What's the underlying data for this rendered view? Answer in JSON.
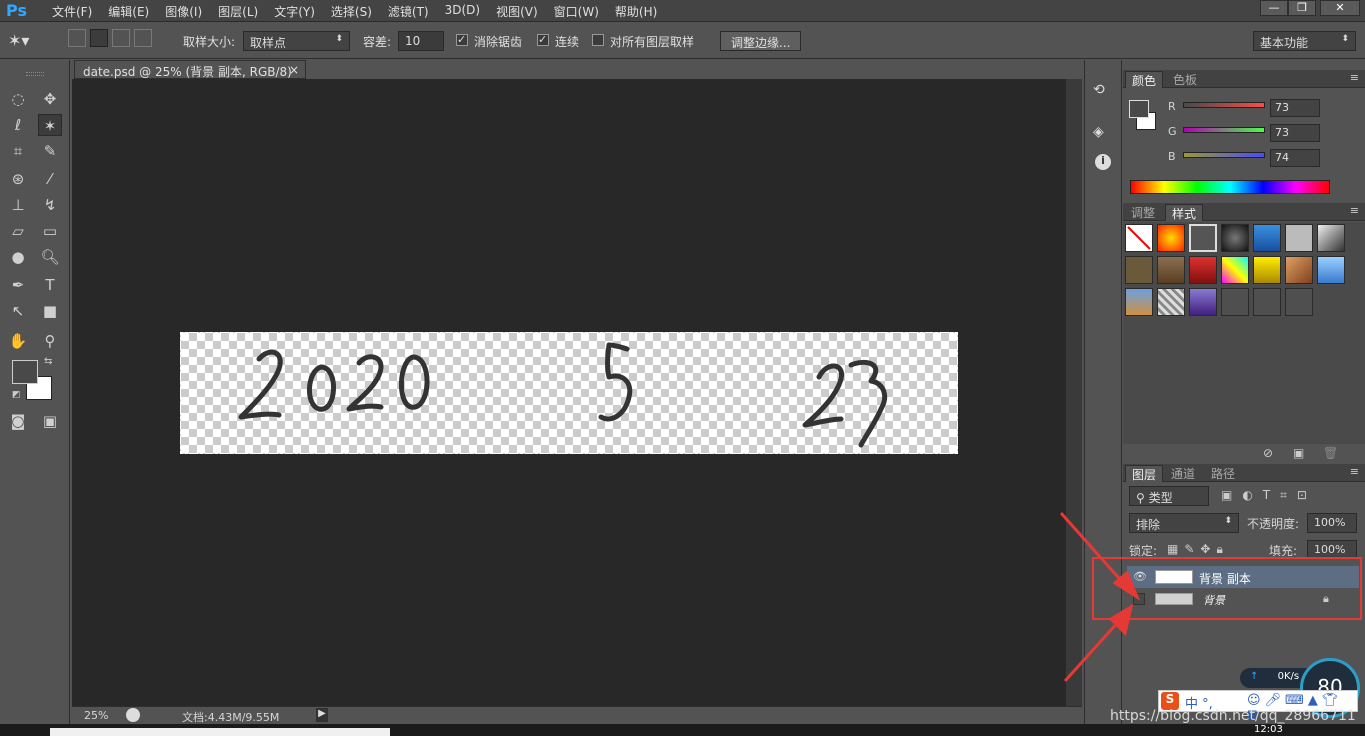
{
  "app": {
    "logo": "Ps",
    "menu": [
      "文件(F)",
      "编辑(E)",
      "图像(I)",
      "图层(L)",
      "文字(Y)",
      "选择(S)",
      "滤镜(T)",
      "3D(D)",
      "视图(V)",
      "窗口(W)",
      "帮助(H)"
    ],
    "window_controls": [
      "—",
      "❐",
      "✕"
    ]
  },
  "options_bar": {
    "sample_size_label": "取样大小:",
    "sample_size_value": "取样点",
    "tolerance_label": "容差:",
    "tolerance_value": "10",
    "antialias_label": "消除锯齿",
    "contiguous_label": "连续",
    "all_layers_label": "对所有图层取样",
    "refine_edge_button": "调整边缘...",
    "workspace_value": "基本功能"
  },
  "document": {
    "tab_title": "date.psd @ 25% (背景 副本, RGB/8) *",
    "tab_close": "×",
    "image_text": [
      "2020",
      "5",
      "23"
    ],
    "zoom": "25%",
    "doc_info": "文档:4.43M/9.55M"
  },
  "color_panel": {
    "tabs": [
      "颜色",
      "色板"
    ],
    "r_label": "R",
    "g_label": "G",
    "b_label": "B",
    "r_value": "73",
    "g_value": "73",
    "b_value": "74"
  },
  "styles_panel": {
    "tabs": [
      "调整",
      "样式"
    ]
  },
  "layers_panel": {
    "tabs": [
      "图层",
      "通道",
      "路径"
    ],
    "filter_label": "类型",
    "blend_mode": "排除",
    "opacity_label": "不透明度:",
    "opacity_value": "100%",
    "lock_label": "锁定:",
    "fill_label": "填充:",
    "fill_value": "100%",
    "layers": [
      {
        "name": "背景 副本",
        "visible": true,
        "selected": true,
        "locked": false
      },
      {
        "name": "背景",
        "visible": false,
        "selected": false,
        "locked": true
      }
    ]
  },
  "overlays": {
    "net_speed": "0K/s",
    "gauge_value": "80",
    "ime_text": "中 °,",
    "watermark": "https://blog.csdn.net/qq_28966711",
    "clock": "12:03"
  },
  "colors": {
    "accent_red": "#e53935",
    "ps_blue": "#31a8ff",
    "canvas_bg": "#282828",
    "panel_bg": "#535353"
  }
}
